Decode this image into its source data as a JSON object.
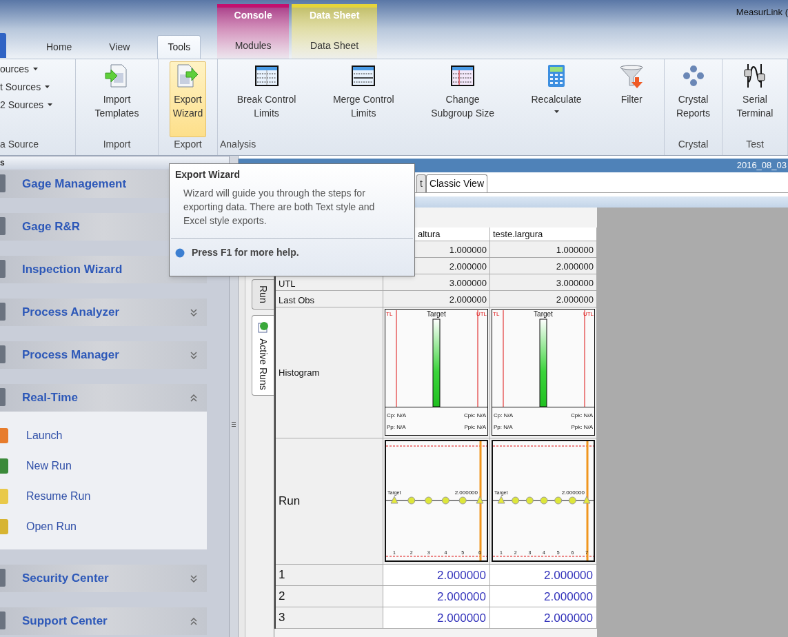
{
  "window": {
    "title": "MeasurLink ("
  },
  "ribbon_tabs": [
    {
      "label": "Home",
      "selected": false
    },
    {
      "label": "View",
      "selected": false
    },
    {
      "label": "Tools",
      "selected": true
    }
  ],
  "contextual_tabs": [
    {
      "header": "Console",
      "label": "Modules",
      "color": "#c2106e"
    },
    {
      "header": "Data Sheet",
      "label": "Data Sheet",
      "color": "#e6d43a"
    }
  ],
  "ribbon_groups": [
    {
      "label": "a Source",
      "kind": "list",
      "items": [
        {
          "label": "ources",
          "dropdown": true
        },
        {
          "label": "t Sources",
          "dropdown": true
        },
        {
          "label": "2 Sources",
          "dropdown": true
        }
      ]
    },
    {
      "label": "Import",
      "kind": "buttons",
      "buttons": [
        {
          "lines": [
            "Import",
            "Templates"
          ],
          "highlighted": false,
          "dropdown": false
        }
      ]
    },
    {
      "label": "Export",
      "kind": "buttons",
      "buttons": [
        {
          "lines": [
            "Export",
            "Wizard"
          ],
          "highlighted": true,
          "dropdown": false
        }
      ]
    },
    {
      "label": "Analysis",
      "kind": "buttons",
      "buttons": [
        {
          "lines": [
            "Break Control",
            "Limits"
          ],
          "highlighted": false,
          "dropdown": false
        },
        {
          "lines": [
            "Merge Control",
            "Limits"
          ],
          "highlighted": false,
          "dropdown": false
        },
        {
          "lines": [
            "Change",
            "Subgroup Size"
          ],
          "highlighted": false,
          "dropdown": false
        },
        {
          "lines": [
            "Recalculate"
          ],
          "highlighted": false,
          "dropdown": true
        },
        {
          "lines": [
            "Filter"
          ],
          "highlighted": false,
          "dropdown": false
        }
      ]
    },
    {
      "label": "Crystal",
      "kind": "buttons",
      "buttons": [
        {
          "lines": [
            "Crystal",
            "Reports"
          ],
          "highlighted": false,
          "dropdown": false
        }
      ]
    },
    {
      "label": "Test",
      "kind": "buttons",
      "buttons": [
        {
          "lines": [
            "Serial",
            "Terminal"
          ],
          "highlighted": false,
          "dropdown": false
        }
      ]
    }
  ],
  "pane_header": "s",
  "sidebar": {
    "sections": [
      {
        "label": "Gage Management"
      },
      {
        "label": "Gage R&R"
      },
      {
        "label": "Inspection Wizard"
      },
      {
        "label": "Process Analyzer",
        "expanded": false
      },
      {
        "label": "Process Manager",
        "expanded": false
      },
      {
        "label": "Real-Time",
        "expanded": true,
        "items": [
          "Launch",
          "New Run",
          "Resume Run",
          "Open Run"
        ]
      },
      {
        "label": "Security Center",
        "expanded": false
      },
      {
        "label": "Support Center",
        "expanded": true
      }
    ]
  },
  "document_title": "2016_08_03",
  "view_tabs": [
    {
      "label": "t",
      "selected": false
    },
    {
      "label": "Classic View",
      "selected": true
    }
  ],
  "side_tabs": [
    {
      "label": "Run",
      "selected": false
    },
    {
      "label": "Active Runs",
      "selected": true
    }
  ],
  "table": {
    "columns": [
      {
        "label": "altura"
      },
      {
        "label": "teste.largura"
      }
    ],
    "rows": [
      {
        "kind": "stat",
        "values": [
          "1.000000",
          "1.000000"
        ]
      },
      {
        "kind": "stat",
        "values": [
          "2.000000",
          "2.000000"
        ]
      },
      {
        "kind": "stat",
        "label": "UTL",
        "values": [
          "3.000000",
          "3.000000"
        ]
      },
      {
        "kind": "stat",
        "label": "Last Obs",
        "values": [
          "2.000000",
          "2.000000"
        ]
      },
      {
        "kind": "histogram",
        "label": "Histogram",
        "charts": [
          {
            "limits": [
              "TL",
              "UTL"
            ],
            "target": "Target",
            "stats": [
              "Cp: N/A",
              "Cpk: N/A",
              "Pp: N/A",
              "Ppk: N/A"
            ]
          },
          {
            "limits": [
              "TL",
              "UTL"
            ],
            "target": "Target",
            "stats": [
              "Cp: N/A",
              "Cpk: N/A",
              "Pp: N/A",
              "Ppk: N/A"
            ]
          }
        ]
      },
      {
        "kind": "run",
        "label": "Run",
        "charts": [
          {
            "target": "Target",
            "value": "2.000000",
            "x_labels": [
              "1",
              "2",
              "3",
              "4",
              "5",
              "6"
            ]
          },
          {
            "target": "Target",
            "value": "2.000000",
            "x_labels": [
              "1",
              "2",
              "3",
              "4",
              "5",
              "6",
              "7"
            ]
          }
        ]
      },
      {
        "kind": "value",
        "label": "1",
        "values": [
          "2.000000",
          "2.000000"
        ]
      },
      {
        "kind": "value",
        "label": "2",
        "values": [
          "2.000000",
          "2.000000"
        ]
      },
      {
        "kind": "value",
        "label": "3",
        "values": [
          "2.000000",
          "2.000000"
        ]
      }
    ]
  },
  "tooltip": {
    "title": "Export Wizard",
    "body": "Wizard will guide you through the steps for exporting data. There are both Text style and Excel style exports.",
    "help": "Press F1 for more help."
  }
}
